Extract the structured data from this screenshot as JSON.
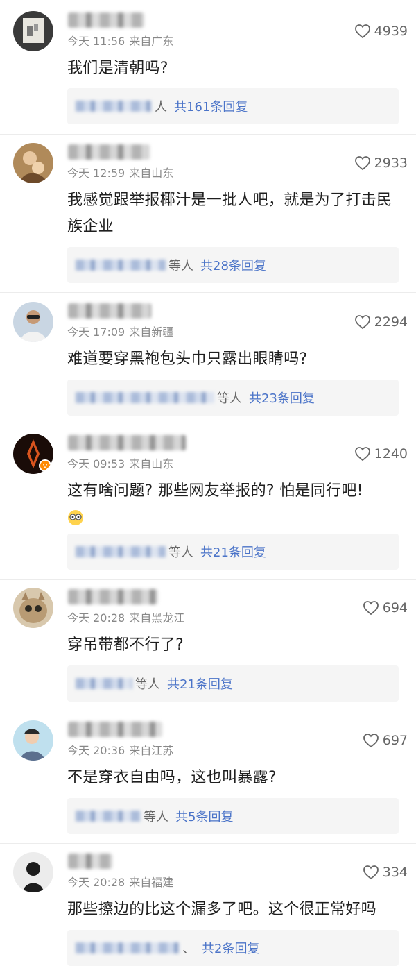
{
  "colors": {
    "link": "#4a73c8",
    "meta": "#888888",
    "box": "#f5f5f5"
  },
  "comments": [
    {
      "time": "今天 11:56",
      "location": "来自广东",
      "likes": "4939",
      "text": "我们是清朝吗?",
      "reply_suffix": "人",
      "reply_count": "共161条回复",
      "avatar": "wall-photo"
    },
    {
      "time": "今天 12:59",
      "location": "来自山东",
      "likes": "2933",
      "text": "我感觉跟举报椰汁是一批人吧，就是为了打击民族企业",
      "reply_suffix": "等人",
      "reply_count": "共28条回复",
      "avatar": "painting"
    },
    {
      "time": "今天 17:09",
      "location": "来自新疆",
      "likes": "2294",
      "text": "难道要穿黑袍包头巾只露出眼睛吗?",
      "reply_suffix": "等人",
      "reply_count": "共23条回复",
      "avatar": "man-sunglasses"
    },
    {
      "time": "今天 09:53",
      "location": "来自山东",
      "likes": "1240",
      "text": "这有啥问题? 那些网友举报的? 怕是同行吧!",
      "reply_suffix": "等人",
      "reply_count": "共21条回复",
      "avatar": "emblem"
    },
    {
      "time": "今天 20:28",
      "location": "来自黑龙江",
      "likes": "694",
      "text": "穿吊带都不行了?",
      "reply_suffix": "等人",
      "reply_count": "共21条回复",
      "avatar": "cat"
    },
    {
      "time": "今天 20:36",
      "location": "来自江苏",
      "likes": "697",
      "text": "不是穿衣自由吗，这也叫暴露?",
      "reply_suffix": "等人",
      "reply_count": "共5条回复",
      "avatar": "boy"
    },
    {
      "time": "今天 20:28",
      "location": "来自福建",
      "likes": "334",
      "text": "那些擦边的比这个漏多了吧。这个很正常好吗",
      "reply_suffix": "、",
      "reply_count": "共2条回复",
      "avatar": "silhouette"
    }
  ]
}
